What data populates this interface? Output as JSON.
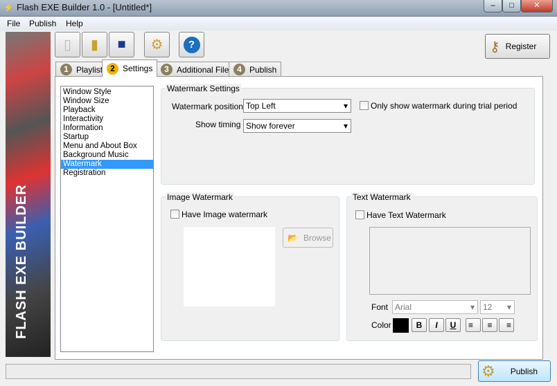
{
  "window": {
    "title": "Flash EXE Builder 1.0 - [Untitled*]",
    "minimize": "–",
    "maximize": "□",
    "close": "✕"
  },
  "menu": [
    "File",
    "Publish",
    "Help"
  ],
  "banner": {
    "text": "FLASH EXE BUILDER"
  },
  "toolbar": {
    "register": "Register"
  },
  "tabs": [
    {
      "num": "1",
      "label": "Playlist"
    },
    {
      "num": "2",
      "label": "Settings"
    },
    {
      "num": "3",
      "label": "Additional Files"
    },
    {
      "num": "4",
      "label": "Publish"
    }
  ],
  "list": [
    "Window Style",
    "Window Size",
    "Playback",
    "Interactivity",
    "Information",
    "Startup",
    "Menu and About Box",
    "Background Music",
    "Watermark",
    "Registration"
  ],
  "watermark_settings": {
    "title": "Watermark Settings",
    "position_label": "Watermark position",
    "position": "Top Left",
    "timing_label": "Show timing",
    "timing": "Show forever",
    "trial_only": "Only show watermark during trial period"
  },
  "image_watermark": {
    "title": "Image Watermark",
    "have": "Have Image watermark",
    "browse": "Browse"
  },
  "text_watermark": {
    "title": "Text Watermark",
    "have": "Have Text Watermark",
    "font_label": "Font",
    "font": "Arial",
    "size": "12",
    "color_label": "Color",
    "color": "#000000",
    "bold": "B",
    "italic": "I",
    "underline": "U"
  },
  "footer": {
    "publish": "Publish"
  }
}
